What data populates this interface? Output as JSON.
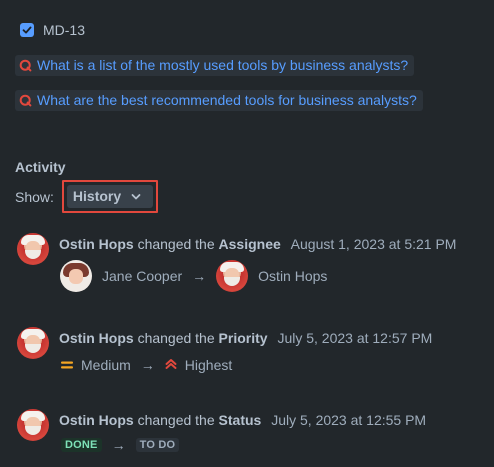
{
  "linked_issue": {
    "key": "MD-13",
    "checked": true
  },
  "questions": [
    {
      "text": "What is a list of the mostly used tools by business analysts?"
    },
    {
      "text": "What are the best recommended tools for business analysts?"
    }
  ],
  "activity": {
    "title": "Activity",
    "show_label": "Show:",
    "filter_value": "History"
  },
  "history": [
    {
      "author": "Ostin Hops",
      "verb": "changed the",
      "field": "Assignee",
      "date": "August 1, 2023 at 5:21 PM",
      "from": "Jane Cooper",
      "to": "Ostin Hops"
    },
    {
      "author": "Ostin Hops",
      "verb": "changed the",
      "field": "Priority",
      "date": "July 5, 2023 at 12:57 PM",
      "from": "Medium",
      "to": "Highest"
    },
    {
      "author": "Ostin Hops",
      "verb": "changed the",
      "field": "Status",
      "date": "July 5, 2023 at 12:55 PM",
      "from": "DONE",
      "to": "TO DO"
    }
  ],
  "arrow": "→",
  "colors": {
    "background": "#22272b",
    "link": "#579dff",
    "highlight_border": "#e2483d",
    "medium_priority": "#f5a623",
    "highest_priority": "#e2483d",
    "done_lozenge_text": "#7ee2b8"
  }
}
